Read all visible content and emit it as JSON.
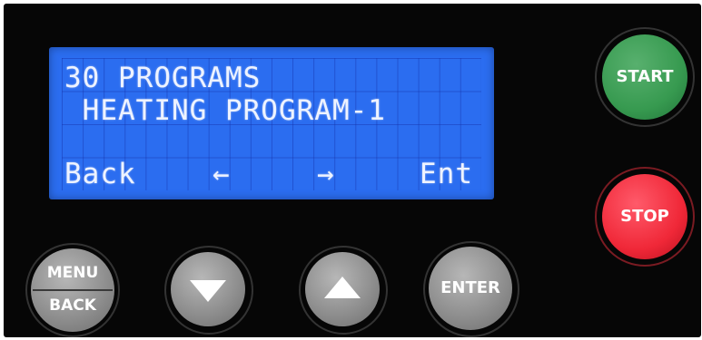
{
  "lcd": {
    "line1": "30 PROGRAMS",
    "line2": " HEATING PROGRAM-1",
    "softkeys": {
      "back": "Back",
      "left": "←",
      "right": "→",
      "enter": "Ent"
    },
    "background_color": "#2b6df0"
  },
  "buttons": {
    "start": "START",
    "stop": "STOP",
    "menu_top": "MENU",
    "menu_bottom": "BACK",
    "down_icon": "triangle-down-icon",
    "up_icon": "triangle-up-icon",
    "enter": "ENTER"
  },
  "colors": {
    "start": "#379a50",
    "stop": "#f02838",
    "keys": "#8f8f8f",
    "panel": "#060606"
  }
}
